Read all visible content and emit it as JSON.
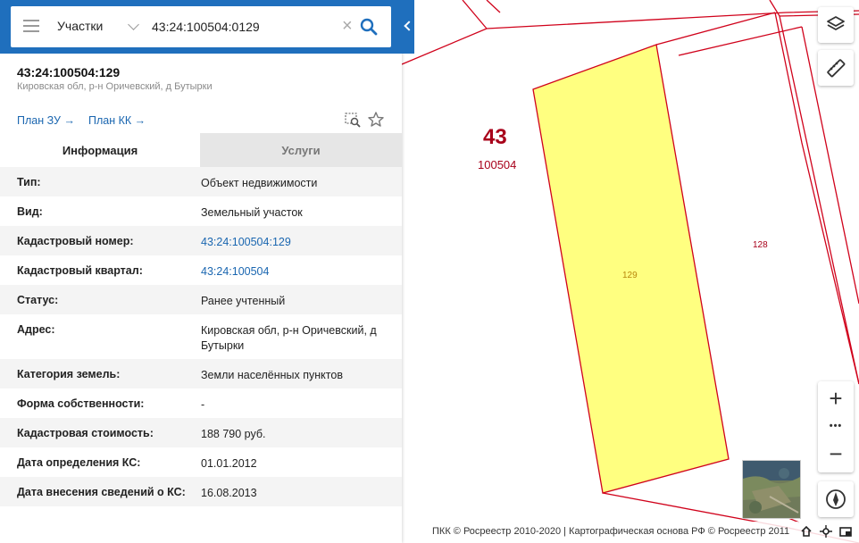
{
  "search": {
    "layer": "Участки",
    "value": "43:24:100504:0129",
    "placeholder": ""
  },
  "object": {
    "cadastral_number": "43:24:100504:129",
    "address": "Кировская обл, р-н Оричевский, д Бутырки"
  },
  "links": {
    "plan_zu": "План ЗУ",
    "plan_kk": "План КК"
  },
  "tabs": {
    "info": "Информация",
    "services": "Услуги"
  },
  "info_rows": [
    {
      "label": "Тип:",
      "value": "Объект недвижимости"
    },
    {
      "label": "Вид:",
      "value": "Земельный участок"
    },
    {
      "label": "Кадастровый номер:",
      "value": "43:24:100504:129"
    },
    {
      "label": "Кадастровый квартал:",
      "value": "43:24:100504"
    },
    {
      "label": "Статус:",
      "value": "Ранее учтенный"
    },
    {
      "label": "Адрес:",
      "value": "Кировская обл, р-н Оричевский, д Бутырки"
    },
    {
      "label": "Категория земель:",
      "value": "Земли населённых пунктов"
    },
    {
      "label": "Форма собственности:",
      "value": "-"
    },
    {
      "label": "Кадастровая стоимость:",
      "value": "188 790 руб."
    },
    {
      "label": "Дата определения КС:",
      "value": "01.01.2012"
    },
    {
      "label": "Дата внесения сведений о КС:",
      "value": "16.08.2013"
    }
  ],
  "map": {
    "district_number": "43",
    "quarter_number": "100504",
    "parcel_selected": "129",
    "parcel_neighbor": "128",
    "colors": {
      "boundary": "#d0021b",
      "parcel_fill": "#ffff80",
      "parcel_label": "#b8860b",
      "district_label": "#a8001a",
      "accent": "#1f6fbd"
    }
  },
  "zoom": {
    "in": "+",
    "more": "•••",
    "out": "−"
  },
  "footer": {
    "copyright": "ПКК © Росреестр 2010-2020 | Картографическая основа РФ © Росреестр 2011"
  },
  "icons": [
    "menu-icon",
    "chevron-down-icon",
    "clear-icon",
    "search-icon",
    "collapse-icon",
    "arrow-right-icon",
    "zoom-to-object-icon",
    "star-icon",
    "layers-icon",
    "ruler-icon",
    "compass-icon",
    "home-icon",
    "locate-icon",
    "fullscreen-icon"
  ]
}
